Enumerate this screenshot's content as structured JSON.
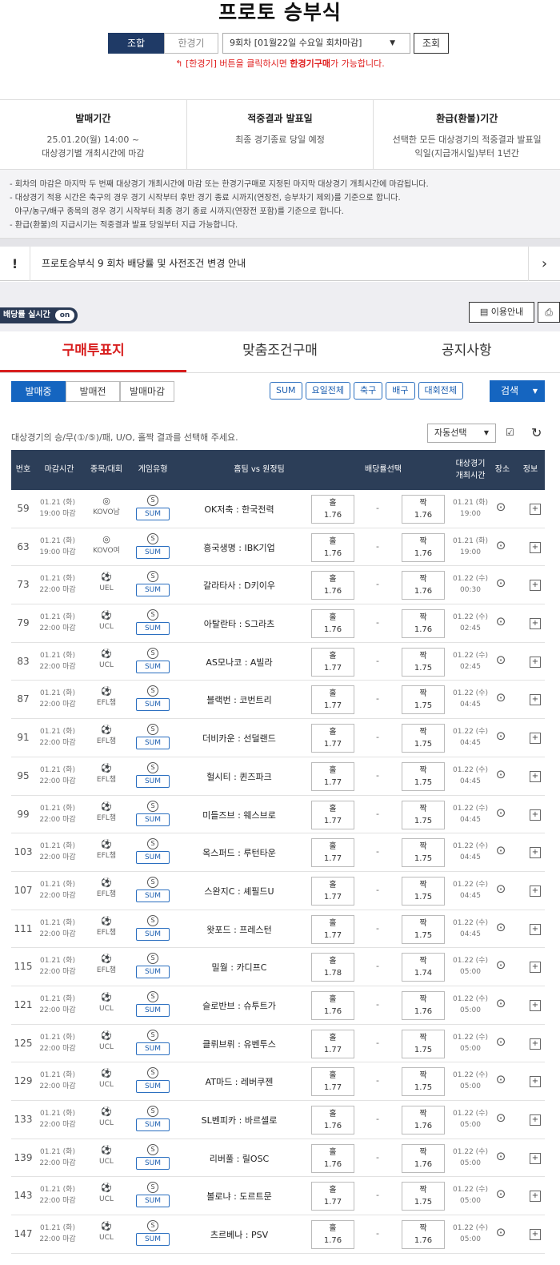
{
  "page_title": "프로토 승부식",
  "mode_tabs": {
    "combo": "조합",
    "single": "한경기"
  },
  "round_select": {
    "value": "9회차 [01월22일 수요일 회차마감]"
  },
  "view_button": "조회",
  "hint": {
    "prefix": "[한경기] 버튼을 클릭하시면 ",
    "bold": "한경기구매",
    "suffix": "가 가능합니다."
  },
  "info": [
    {
      "heading": "발매기간",
      "line1": "25.01.20(월) 14:00 ~",
      "line2": "대상경기별 개최시간에 마감"
    },
    {
      "heading": "적중결과 발표일",
      "line1": "최종 경기종료 당일 예정",
      "line2": ""
    },
    {
      "heading": "환급(환불)기간",
      "line1": "선택한 모든 대상경기의 적중결과 발표일",
      "line2": "익일(지급개시일)부터 1년간"
    }
  ],
  "notes": [
    "- 회차의 마감은 마지막 두 번째 대상경기 개최시간에 마감 또는 한경기구매로 지정된 마지막 대상경기 개최시간에 마감됩니다.",
    "- 대상경기 적용 시간은 축구의 경우 경기 시작부터 후반 경기 종료 시까지(연장전, 승부차기 제외)를 기준으로 합니다.",
    "  야구/농구/배구 종목의 경우 경기 시작부터 최종 경기 종료 시까지(연장전 포함)를 기준으로 합니다.",
    "- 환급(환불)의 지급시기는 적중결과 발표 당일부터 지급 가능합니다."
  ],
  "notice": {
    "bang": "!",
    "text": "프로토승부식 9 회차 배당률 및 사전조건 변경 안내",
    "arrow": "›"
  },
  "odds_toggle": {
    "label": "배당률 실시간",
    "state": "on"
  },
  "guide_button": "이용안내",
  "main_tabs": [
    "구매투표지",
    "맞춤조건구매",
    "공지사항"
  ],
  "sub_tabs": [
    "발매중",
    "발매전",
    "발매마감"
  ],
  "filters": [
    "SUM",
    "요일전체",
    "축구",
    "배구",
    "대회전체"
  ],
  "search_button": "검색",
  "prompt": "대상경기의 승/무(①/⑤)/패, U/O, 홀짝 결과를 선택해 주세요.",
  "auto_select": "자동선택",
  "table_headers": {
    "no": "번호",
    "deadline": "마감시간",
    "league": "종목/대회",
    "type": "게임유형",
    "match": "홈팀 vs 원정팀",
    "odds": "배당률선택",
    "game_time_1": "대상경기",
    "game_time_2": "개최시간",
    "venue": "장소",
    "info": "정보"
  },
  "rows": [
    {
      "no": "59",
      "d1": "01.21 (화)",
      "d2": "19:00 마감",
      "league": "KOVO남",
      "match": "OK저축 : 한국전력",
      "o1": "1.76",
      "o2": "1.76",
      "g1": "01.21 (화)",
      "g2": "19:00"
    },
    {
      "no": "63",
      "d1": "01.21 (화)",
      "d2": "19:00 마감",
      "league": "KOVO여",
      "match": "흥국생명 : IBK기업",
      "o1": "1.76",
      "o2": "1.76",
      "g1": "01.21 (화)",
      "g2": "19:00"
    },
    {
      "no": "73",
      "d1": "01.21 (화)",
      "d2": "22:00 마감",
      "league": "UEL",
      "match": "갈라타사 : D키이우",
      "o1": "1.76",
      "o2": "1.76",
      "g1": "01.22 (수)",
      "g2": "00:30"
    },
    {
      "no": "79",
      "d1": "01.21 (화)",
      "d2": "22:00 마감",
      "league": "UCL",
      "match": "아탈란타 : S그라츠",
      "o1": "1.76",
      "o2": "1.76",
      "g1": "01.22 (수)",
      "g2": "02:45"
    },
    {
      "no": "83",
      "d1": "01.21 (화)",
      "d2": "22:00 마감",
      "league": "UCL",
      "match": "AS모나코 : A빌라",
      "o1": "1.77",
      "o2": "1.75",
      "g1": "01.22 (수)",
      "g2": "02:45"
    },
    {
      "no": "87",
      "d1": "01.21 (화)",
      "d2": "22:00 마감",
      "league": "EFL챔",
      "match": "블랙번 : 코번트리",
      "o1": "1.77",
      "o2": "1.75",
      "g1": "01.22 (수)",
      "g2": "04:45"
    },
    {
      "no": "91",
      "d1": "01.21 (화)",
      "d2": "22:00 마감",
      "league": "EFL챔",
      "match": "더비카운 : 선덜랜드",
      "o1": "1.77",
      "o2": "1.75",
      "g1": "01.22 (수)",
      "g2": "04:45"
    },
    {
      "no": "95",
      "d1": "01.21 (화)",
      "d2": "22:00 마감",
      "league": "EFL챔",
      "match": "헐시티 : 퀸즈파크",
      "o1": "1.77",
      "o2": "1.75",
      "g1": "01.22 (수)",
      "g2": "04:45"
    },
    {
      "no": "99",
      "d1": "01.21 (화)",
      "d2": "22:00 마감",
      "league": "EFL챔",
      "match": "미들즈브 : 웨스브로",
      "o1": "1.77",
      "o2": "1.75",
      "g1": "01.22 (수)",
      "g2": "04:45"
    },
    {
      "no": "103",
      "d1": "01.21 (화)",
      "d2": "22:00 마감",
      "league": "EFL챔",
      "match": "옥스퍼드 : 루턴타운",
      "o1": "1.77",
      "o2": "1.75",
      "g1": "01.22 (수)",
      "g2": "04:45"
    },
    {
      "no": "107",
      "d1": "01.21 (화)",
      "d2": "22:00 마감",
      "league": "EFL챔",
      "match": "스완지C : 셰필드U",
      "o1": "1.77",
      "o2": "1.75",
      "g1": "01.22 (수)",
      "g2": "04:45"
    },
    {
      "no": "111",
      "d1": "01.21 (화)",
      "d2": "22:00 마감",
      "league": "EFL챔",
      "match": "왓포드 : 프레스턴",
      "o1": "1.77",
      "o2": "1.75",
      "g1": "01.22 (수)",
      "g2": "04:45"
    },
    {
      "no": "115",
      "d1": "01.21 (화)",
      "d2": "22:00 마감",
      "league": "EFL챔",
      "match": "밀월 : 카디프C",
      "o1": "1.78",
      "o2": "1.74",
      "g1": "01.22 (수)",
      "g2": "05:00"
    },
    {
      "no": "121",
      "d1": "01.21 (화)",
      "d2": "22:00 마감",
      "league": "UCL",
      "match": "슬로반브 : 슈투트가",
      "o1": "1.76",
      "o2": "1.76",
      "g1": "01.22 (수)",
      "g2": "05:00"
    },
    {
      "no": "125",
      "d1": "01.21 (화)",
      "d2": "22:00 마감",
      "league": "UCL",
      "match": "클뤼브뤼 : 유벤투스",
      "o1": "1.77",
      "o2": "1.75",
      "g1": "01.22 (수)",
      "g2": "05:00"
    },
    {
      "no": "129",
      "d1": "01.21 (화)",
      "d2": "22:00 마감",
      "league": "UCL",
      "match": "AT마드 : 레버쿠젠",
      "o1": "1.77",
      "o2": "1.75",
      "g1": "01.22 (수)",
      "g2": "05:00"
    },
    {
      "no": "133",
      "d1": "01.21 (화)",
      "d2": "22:00 마감",
      "league": "UCL",
      "match": "SL벤피카 : 바르셀로",
      "o1": "1.76",
      "o2": "1.76",
      "g1": "01.22 (수)",
      "g2": "05:00"
    },
    {
      "no": "139",
      "d1": "01.21 (화)",
      "d2": "22:00 마감",
      "league": "UCL",
      "match": "리버풀 : 릴OSC",
      "o1": "1.76",
      "o2": "1.76",
      "g1": "01.22 (수)",
      "g2": "05:00"
    },
    {
      "no": "143",
      "d1": "01.21 (화)",
      "d2": "22:00 마감",
      "league": "UCL",
      "match": "볼로냐 : 도르트문",
      "o1": "1.77",
      "o2": "1.75",
      "g1": "01.22 (수)",
      "g2": "05:00"
    },
    {
      "no": "147",
      "d1": "01.21 (화)",
      "d2": "22:00 마감",
      "league": "UCL",
      "match": "츠르베나 : PSV",
      "o1": "1.76",
      "o2": "1.76",
      "g1": "01.22 (수)",
      "g2": "05:00"
    }
  ],
  "row_labels": {
    "odd": "홀",
    "even": "짝",
    "dash": "-",
    "sum": "SUM",
    "s": "S"
  }
}
